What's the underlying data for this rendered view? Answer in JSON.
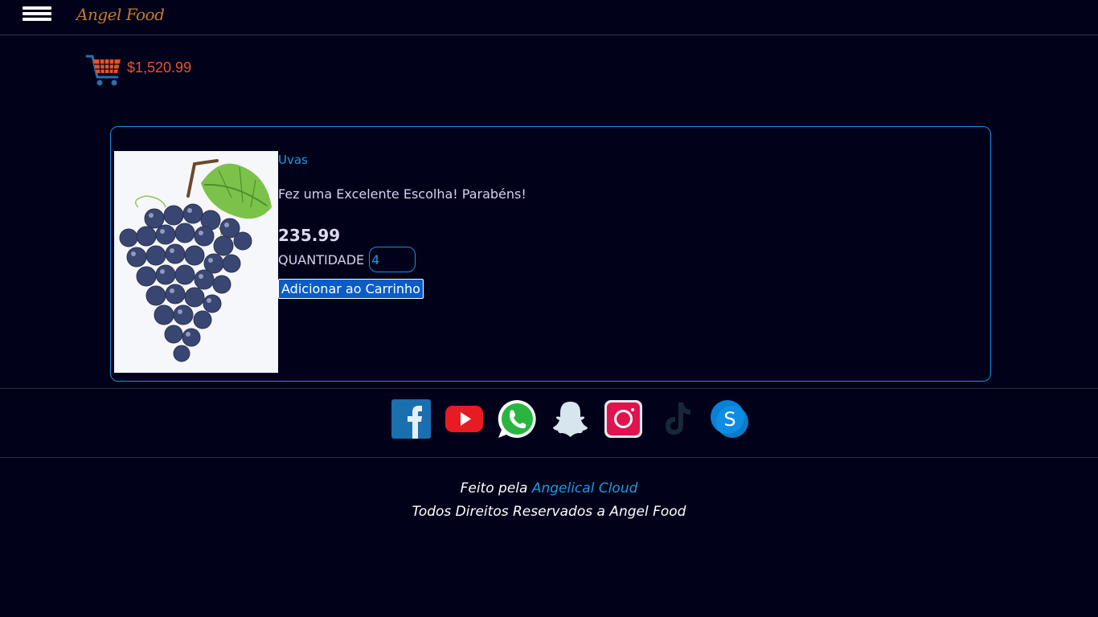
{
  "header": {
    "brand": "Angel Food",
    "menu_icon": "hamburger-menu-icon"
  },
  "cart": {
    "icon": "shopping-cart-icon",
    "total": "$1,520.99",
    "color": "#e8532a"
  },
  "product": {
    "name": "Uvas",
    "message": "Fez uma Excelente Escolha! Parabéns!",
    "price": "235.99",
    "quantity_label": "QUANTIDADE",
    "quantity_value": "4",
    "add_button_label": "Adicionar ao Carrinho"
  },
  "social": [
    {
      "name": "facebook-icon"
    },
    {
      "name": "youtube-icon"
    },
    {
      "name": "whatsapp-icon"
    },
    {
      "name": "snapchat-icon"
    },
    {
      "name": "instagram-icon"
    },
    {
      "name": "tiktok-icon"
    },
    {
      "name": "skype-icon"
    }
  ],
  "footer": {
    "made_by_prefix": "Feito pela ",
    "made_by_link": "Angelical Cloud",
    "rights": "Todos Direitos Reservados a Angel Food"
  },
  "colors": {
    "background": "#01021a",
    "accent": "#1e9be0",
    "brand": "#c47a2c",
    "button": "#0a5cc7"
  }
}
